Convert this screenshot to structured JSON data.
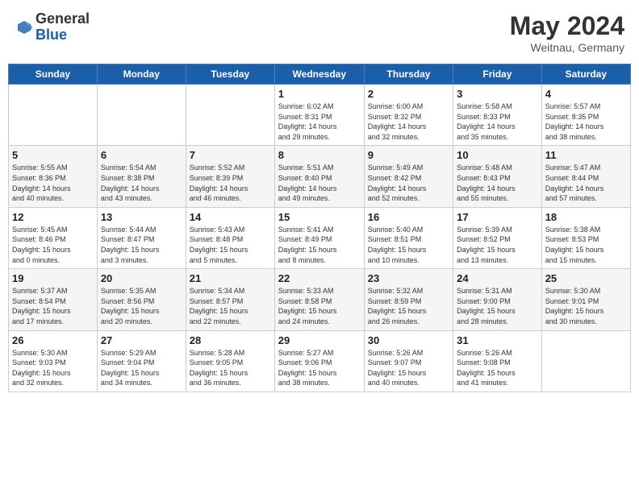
{
  "logo": {
    "general": "General",
    "blue": "Blue"
  },
  "title": {
    "month": "May 2024",
    "location": "Weitnau, Germany"
  },
  "weekdays": [
    "Sunday",
    "Monday",
    "Tuesday",
    "Wednesday",
    "Thursday",
    "Friday",
    "Saturday"
  ],
  "weeks": [
    [
      {
        "day": "",
        "info": ""
      },
      {
        "day": "",
        "info": ""
      },
      {
        "day": "",
        "info": ""
      },
      {
        "day": "1",
        "info": "Sunrise: 6:02 AM\nSunset: 8:31 PM\nDaylight: 14 hours\nand 29 minutes."
      },
      {
        "day": "2",
        "info": "Sunrise: 6:00 AM\nSunset: 8:32 PM\nDaylight: 14 hours\nand 32 minutes."
      },
      {
        "day": "3",
        "info": "Sunrise: 5:58 AM\nSunset: 8:33 PM\nDaylight: 14 hours\nand 35 minutes."
      },
      {
        "day": "4",
        "info": "Sunrise: 5:57 AM\nSunset: 8:35 PM\nDaylight: 14 hours\nand 38 minutes."
      }
    ],
    [
      {
        "day": "5",
        "info": "Sunrise: 5:55 AM\nSunset: 8:36 PM\nDaylight: 14 hours\nand 40 minutes."
      },
      {
        "day": "6",
        "info": "Sunrise: 5:54 AM\nSunset: 8:38 PM\nDaylight: 14 hours\nand 43 minutes."
      },
      {
        "day": "7",
        "info": "Sunrise: 5:52 AM\nSunset: 8:39 PM\nDaylight: 14 hours\nand 46 minutes."
      },
      {
        "day": "8",
        "info": "Sunrise: 5:51 AM\nSunset: 8:40 PM\nDaylight: 14 hours\nand 49 minutes."
      },
      {
        "day": "9",
        "info": "Sunrise: 5:49 AM\nSunset: 8:42 PM\nDaylight: 14 hours\nand 52 minutes."
      },
      {
        "day": "10",
        "info": "Sunrise: 5:48 AM\nSunset: 8:43 PM\nDaylight: 14 hours\nand 55 minutes."
      },
      {
        "day": "11",
        "info": "Sunrise: 5:47 AM\nSunset: 8:44 PM\nDaylight: 14 hours\nand 57 minutes."
      }
    ],
    [
      {
        "day": "12",
        "info": "Sunrise: 5:45 AM\nSunset: 8:46 PM\nDaylight: 15 hours\nand 0 minutes."
      },
      {
        "day": "13",
        "info": "Sunrise: 5:44 AM\nSunset: 8:47 PM\nDaylight: 15 hours\nand 3 minutes."
      },
      {
        "day": "14",
        "info": "Sunrise: 5:43 AM\nSunset: 8:48 PM\nDaylight: 15 hours\nand 5 minutes."
      },
      {
        "day": "15",
        "info": "Sunrise: 5:41 AM\nSunset: 8:49 PM\nDaylight: 15 hours\nand 8 minutes."
      },
      {
        "day": "16",
        "info": "Sunrise: 5:40 AM\nSunset: 8:51 PM\nDaylight: 15 hours\nand 10 minutes."
      },
      {
        "day": "17",
        "info": "Sunrise: 5:39 AM\nSunset: 8:52 PM\nDaylight: 15 hours\nand 13 minutes."
      },
      {
        "day": "18",
        "info": "Sunrise: 5:38 AM\nSunset: 8:53 PM\nDaylight: 15 hours\nand 15 minutes."
      }
    ],
    [
      {
        "day": "19",
        "info": "Sunrise: 5:37 AM\nSunset: 8:54 PM\nDaylight: 15 hours\nand 17 minutes."
      },
      {
        "day": "20",
        "info": "Sunrise: 5:35 AM\nSunset: 8:56 PM\nDaylight: 15 hours\nand 20 minutes."
      },
      {
        "day": "21",
        "info": "Sunrise: 5:34 AM\nSunset: 8:57 PM\nDaylight: 15 hours\nand 22 minutes."
      },
      {
        "day": "22",
        "info": "Sunrise: 5:33 AM\nSunset: 8:58 PM\nDaylight: 15 hours\nand 24 minutes."
      },
      {
        "day": "23",
        "info": "Sunrise: 5:32 AM\nSunset: 8:59 PM\nDaylight: 15 hours\nand 26 minutes."
      },
      {
        "day": "24",
        "info": "Sunrise: 5:31 AM\nSunset: 9:00 PM\nDaylight: 15 hours\nand 28 minutes."
      },
      {
        "day": "25",
        "info": "Sunrise: 5:30 AM\nSunset: 9:01 PM\nDaylight: 15 hours\nand 30 minutes."
      }
    ],
    [
      {
        "day": "26",
        "info": "Sunrise: 5:30 AM\nSunset: 9:03 PM\nDaylight: 15 hours\nand 32 minutes."
      },
      {
        "day": "27",
        "info": "Sunrise: 5:29 AM\nSunset: 9:04 PM\nDaylight: 15 hours\nand 34 minutes."
      },
      {
        "day": "28",
        "info": "Sunrise: 5:28 AM\nSunset: 9:05 PM\nDaylight: 15 hours\nand 36 minutes."
      },
      {
        "day": "29",
        "info": "Sunrise: 5:27 AM\nSunset: 9:06 PM\nDaylight: 15 hours\nand 38 minutes."
      },
      {
        "day": "30",
        "info": "Sunrise: 5:26 AM\nSunset: 9:07 PM\nDaylight: 15 hours\nand 40 minutes."
      },
      {
        "day": "31",
        "info": "Sunrise: 5:26 AM\nSunset: 9:08 PM\nDaylight: 15 hours\nand 41 minutes."
      },
      {
        "day": "",
        "info": ""
      }
    ]
  ]
}
